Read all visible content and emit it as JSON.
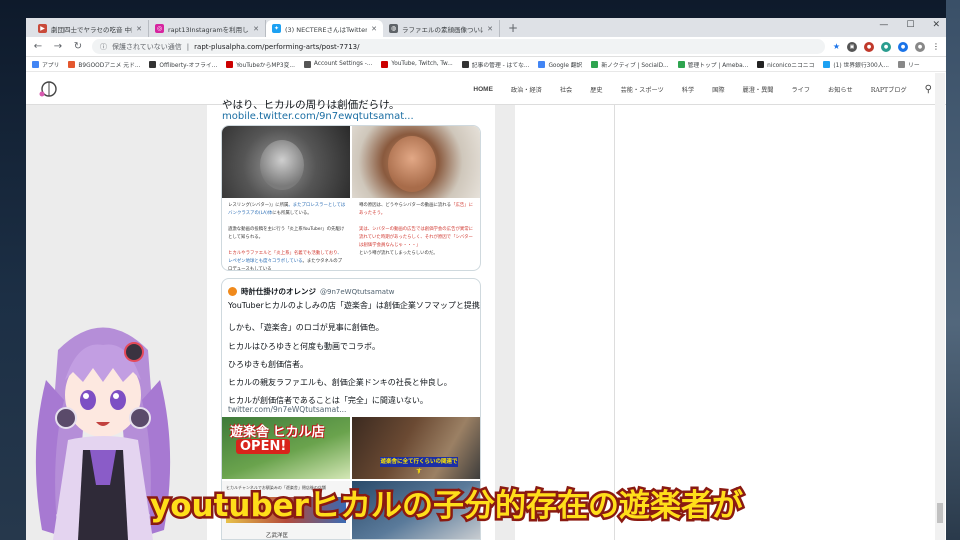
{
  "tabs": [
    {
      "title": "劇団四士でヤラセの吃音 中田敦彦",
      "color": "#c94a3a",
      "glyph": "▶",
      "active": false
    },
    {
      "title": "rapt13Instagramを利用しています",
      "color": "#d6249f",
      "glyph": "◎",
      "active": false
    },
    {
      "title": "(3) NECTEREさんはTwitterを使って",
      "color": "#1da1f2",
      "glyph": "✦",
      "active": true
    },
    {
      "title": "ラファエルの素顔画像ついに特定",
      "color": "#5f6368",
      "glyph": "◍",
      "active": false
    }
  ],
  "toolbar": {
    "security": "保護されていない通信",
    "url": "rapt-plusalpha.com/performing-arts/post-7713/"
  },
  "bookmarks": [
    {
      "label": "アプリ",
      "color": "#4285f4"
    },
    {
      "label": "B9GOODアニメ 元ド...",
      "color": "#e4572e"
    },
    {
      "label": "Offliberty-オフライ...",
      "color": "#333333"
    },
    {
      "label": "YouTubeからMP3変...",
      "color": "#cc0000"
    },
    {
      "label": "Account Settings -...",
      "color": "#555555"
    },
    {
      "label": "YouTube, Twitch, Tw...",
      "color": "#cc0000"
    },
    {
      "label": "記事の管理 - はてな...",
      "color": "#333333"
    },
    {
      "label": "Google 翻訳",
      "color": "#4285f4"
    },
    {
      "label": "新ノクティブ | SocialD...",
      "color": "#2ea44f"
    },
    {
      "label": "管理トップ | Ameba...",
      "color": "#2ea44f"
    },
    {
      "label": "niconicoニコニコ",
      "color": "#222222"
    },
    {
      "label": "(1) 世界銀行300人...",
      "color": "#1da1f2"
    },
    {
      "label": "リー",
      "color": "#888888"
    }
  ],
  "sitenav": [
    "HOME",
    "政治・経済",
    "社会",
    "歴史",
    "芸能・スポーツ",
    "科学",
    "国際",
    "麗澄・異聞",
    "ライフ",
    "お知らせ",
    "RAPTブログ"
  ],
  "page": {
    "top_link": "/youtube/@entertainment/...",
    "tweet1_text": "やはり、ヒカルの周りは創価だらけ。",
    "tweet1_link": "mobile.twitter.com/9n7ewqtutsamat...",
    "card1_cap_left": [
      "レスリング(シバター)」に所属",
      "。またプロレスラーとしてはバンクラスアの(LA)体",
      "にも所属している。",
      "過激な動画の投稿を主に行う「炎上系YouTuber」の先駆けとして知られる。",
      "ヒカルやラファエルと「炎上系」名義でも活動しており",
      "、レペゼン地球とも度々コラボしている",
      "。またウタネルのプロデュースもしている"
    ],
    "card1_cap_right": [
      "噂の原因は、どうやらシバターの動画に流れる",
      "「広告」にあったそう。",
      "実は、シバターの動画の広告では創価学会の広告が異常に流れていた時期があったらしく、それが原因で「シバターは創価学会員なんじゃ・・・」",
      "という噂が流れてしまったらしいのだ。"
    ],
    "tweet2_user": "時計仕掛けのオレンジ",
    "tweet2_handle": "@9n7eWQtutsamatw",
    "tweet2_lines": [
      "YouTuberヒカルのよしみの店「遊楽舎」は創価企業ソフマップと提携。",
      "しかも、「遊楽舎」のロゴが見事に創価色。",
      "ヒカルはひろゆきと何度も動画でコラボ。",
      "ひろゆきも創価信者。",
      "ヒカルの親友ラファエルも、創価企業ドンキの社長と仲良し。",
      "ヒカルが創価信者であることは「完全」に間違いない。"
    ],
    "tweet2_link": "twitter.com/9n7eWQtutsamat...",
    "media_sign": "遊楽舎 ヒカル店",
    "media_open": "OPEN!",
    "media_caption_right": "遊楽舎に全て行くらいの関連です",
    "media_header_left": "ヒカルチャンネルでお馴染みの「遊楽舎」閉店後の店舗",
    "media_name_left": "乙武洋匡"
  },
  "subtitle": "youtuberヒカルの子分的存在の遊楽者が",
  "icons": [
    "back-icon",
    "forward-icon",
    "reload-icon",
    "star-icon",
    "extensions-icon",
    "menu-icon",
    "search-icon"
  ]
}
